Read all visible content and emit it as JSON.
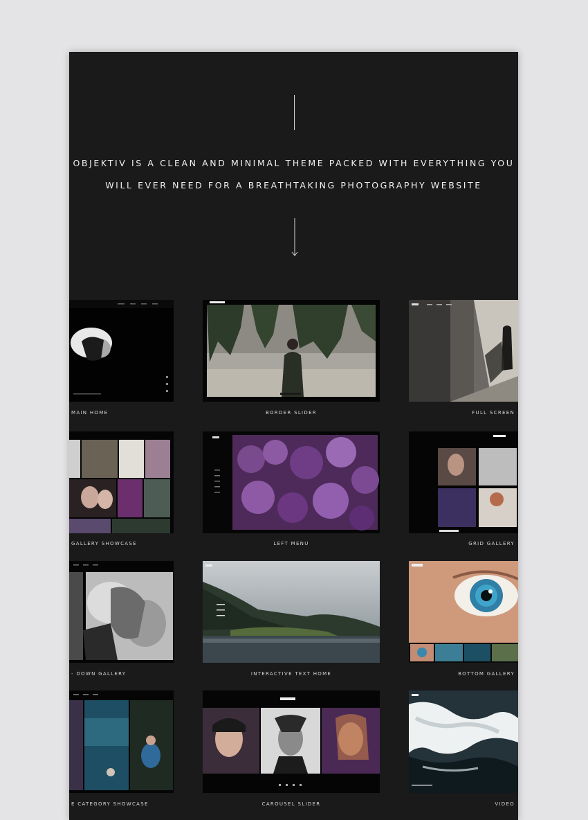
{
  "intro": {
    "line1": "OBJEKTIV IS A CLEAN AND MINIMAL THEME PACKED WITH EVERYTHING YOU",
    "line2": "WILL EVER NEED FOR A BREATHTAKING PHOTOGRAPHY WEBSITE"
  },
  "demos": [
    {
      "label": "MAIN HOME"
    },
    {
      "label": "BORDER SLIDER"
    },
    {
      "label": "FULL SCREEN"
    },
    {
      "label": "GALLERY SHOWCASE"
    },
    {
      "label": "LEFT MENU"
    },
    {
      "label": "GRID GALLERY"
    },
    {
      "label": "- DOWN GALLERY"
    },
    {
      "label": "INTERACTIVE TEXT HOME"
    },
    {
      "label": "BOTTOM GALLERY"
    },
    {
      "label": "E CATEGORY SHOWCASE"
    },
    {
      "label": "CAROUSEL SLIDER"
    },
    {
      "label": "VIDEO"
    }
  ],
  "colors": {
    "panel": "#1a1a1b",
    "page": "#e4e4e6",
    "text": "#f0f0f0"
  }
}
